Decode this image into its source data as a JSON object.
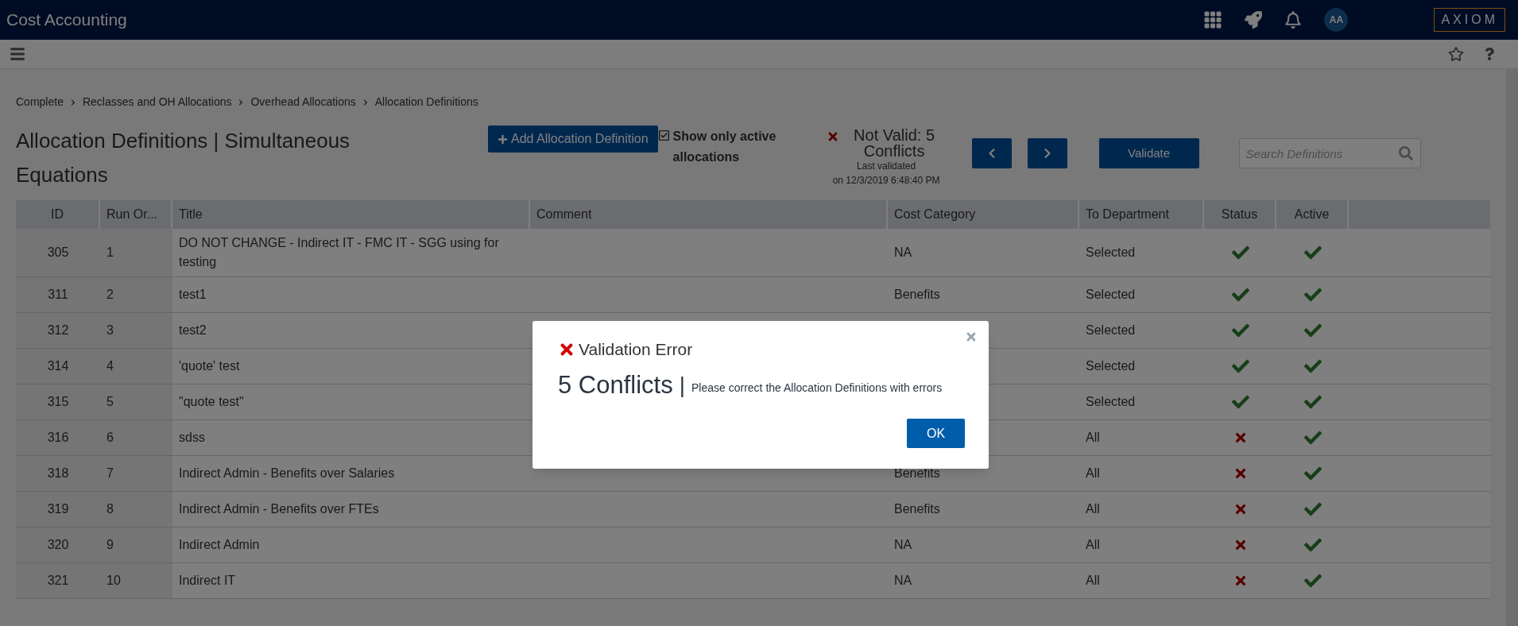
{
  "app": {
    "title": "Cost Accounting",
    "user_initials": "AA",
    "logo": "AXIOM"
  },
  "breadcrumb": [
    "Complete",
    "Reclasses and OH Allocations",
    "Overhead Allocations",
    "Allocation Definitions"
  ],
  "page_title": "Allocation Definitions | Simultaneous Equations",
  "add_button": "Add Allocation Definition",
  "active_filter": {
    "label": "Show only active allocations",
    "checked": true
  },
  "validation_status": {
    "valid": false,
    "headline": "Not Valid: 5 Conflicts",
    "caption": "Last validated",
    "timestamp": "on 12/3/2019 6:48:40 PM"
  },
  "validate_button": "Validate",
  "search": {
    "placeholder": "Search Definitions"
  },
  "table": {
    "columns": [
      "ID",
      "Run Or...",
      "Title",
      "Comment",
      "Cost Category",
      "To Department",
      "Status",
      "Active"
    ],
    "rows": [
      {
        "id": "305",
        "run_order": "1",
        "title": "DO NOT CHANGE - Indirect IT - FMC IT - SGG using for testing",
        "cost_category": "NA",
        "to_department": "Selected",
        "status_ok": true,
        "active": true
      },
      {
        "id": "311",
        "run_order": "2",
        "title": "test1",
        "cost_category": "Benefits",
        "to_department": "Selected",
        "status_ok": true,
        "active": true
      },
      {
        "id": "312",
        "run_order": "3",
        "title": "test2",
        "to_department": "Selected",
        "status_ok": true,
        "active": true
      },
      {
        "id": "314",
        "run_order": "4",
        "title": "'quote' test",
        "to_department": "Selected",
        "status_ok": true,
        "active": true
      },
      {
        "id": "315",
        "run_order": "5",
        "title": "\"quote test\"",
        "to_department": "Selected",
        "status_ok": true,
        "active": true
      },
      {
        "id": "316",
        "run_order": "6",
        "title": "sdss",
        "to_department": "All",
        "status_ok": false,
        "active": true
      },
      {
        "id": "318",
        "run_order": "7",
        "title": "Indirect Admin - Benefits over Salaries",
        "cost_category": "Benefits",
        "to_department": "All",
        "status_ok": false,
        "active": true
      },
      {
        "id": "319",
        "run_order": "8",
        "title": "Indirect Admin - Benefits over FTEs",
        "cost_category": "Benefits",
        "to_department": "All",
        "status_ok": false,
        "active": true
      },
      {
        "id": "320",
        "run_order": "9",
        "title": "Indirect Admin",
        "cost_category": "NA",
        "to_department": "All",
        "status_ok": false,
        "active": true
      },
      {
        "id": "321",
        "run_order": "10",
        "title": "Indirect IT",
        "cost_category": "NA",
        "to_department": "All",
        "status_ok": false,
        "active": true
      }
    ]
  },
  "dialog": {
    "title": "Validation Error",
    "count": "5 Conflicts",
    "separator": "|",
    "message": "Please correct the Allocation Definitions with errors",
    "ok": "OK"
  }
}
